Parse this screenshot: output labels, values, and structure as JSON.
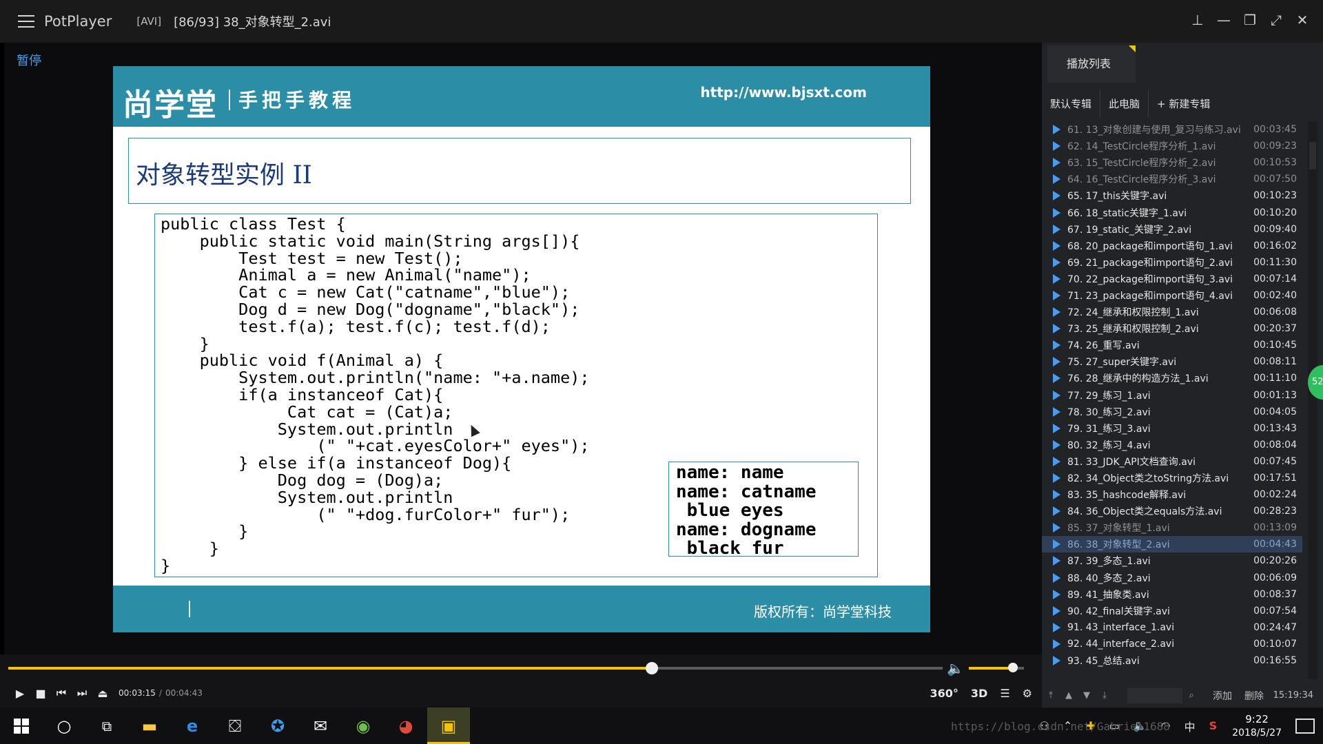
{
  "titlebar": {
    "app_name": "PotPlayer",
    "format": "[AVI]",
    "file_title": "[86/93] 38_对象转型_2.avi"
  },
  "video": {
    "pause_label": "暂停",
    "slide": {
      "logo": "尚学堂",
      "tagline": "手把手教程",
      "url": "http://www.bjsxt.com",
      "title": "对象转型实例 II",
      "code": "public class Test {\n    public static void main(String args[]){\n        Test test = new Test();\n        Animal a = new Animal(\"name\");\n        Cat c = new Cat(\"catname\",\"blue\");\n        Dog d = new Dog(\"dogname\",\"black\");\n        test.f(a); test.f(c); test.f(d);\n    }\n    public void f(Animal a) {\n        System.out.println(\"name: \"+a.name);\n        if(a instanceof Cat){\n             Cat cat = (Cat)a;\n            System.out.println\n                (\" \"+cat.eyesColor+\" eyes\");\n        } else if(a instanceof Dog){\n            Dog dog = (Dog)a;\n            System.out.println\n                (\" \"+dog.furColor+\" fur\");\n        }\n     }\n}",
      "output": "name: name\nname: catname\n blue eyes\nname: dogname\n black fur",
      "copyright": "版权所有：尚学堂科技"
    }
  },
  "playlist": {
    "tab_label": "播放列表",
    "sub_tabs": [
      "默认专辑",
      "此电脑",
      "+ 新建专辑"
    ],
    "items": [
      {
        "name": "61. 13_对象创建与使用_复习与练习.avi",
        "duration": "00:03:45",
        "state": "dim"
      },
      {
        "name": "62. 14_TestCircle程序分析_1.avi",
        "duration": "00:09:23",
        "state": "dim"
      },
      {
        "name": "63. 15_TestCircle程序分析_2.avi",
        "duration": "00:10:53",
        "state": "dim"
      },
      {
        "name": "64. 16_TestCircle程序分析_3.avi",
        "duration": "00:07:50",
        "state": "dim"
      },
      {
        "name": "65. 17_this关键字.avi",
        "duration": "00:10:23",
        "state": ""
      },
      {
        "name": "66. 18_static关键字_1.avi",
        "duration": "00:10:20",
        "state": ""
      },
      {
        "name": "67. 19_static_关键字_2.avi",
        "duration": "00:09:40",
        "state": ""
      },
      {
        "name": "68. 20_package和import语句_1.avi",
        "duration": "00:16:02",
        "state": ""
      },
      {
        "name": "69. 21_package和import语句_2.avi",
        "duration": "00:11:30",
        "state": ""
      },
      {
        "name": "70. 22_package和import语句_3.avi",
        "duration": "00:07:14",
        "state": ""
      },
      {
        "name": "71. 23_package和import语句_4.avi",
        "duration": "00:02:40",
        "state": ""
      },
      {
        "name": "72. 24_继承和权限控制_1.avi",
        "duration": "00:06:08",
        "state": ""
      },
      {
        "name": "73. 25_继承和权限控制_2.avi",
        "duration": "00:20:37",
        "state": ""
      },
      {
        "name": "74. 26_重写.avi",
        "duration": "00:10:45",
        "state": ""
      },
      {
        "name": "75. 27_super关键字.avi",
        "duration": "00:08:11",
        "state": ""
      },
      {
        "name": "76. 28_继承中的构造方法_1.avi",
        "duration": "00:11:10",
        "state": ""
      },
      {
        "name": "77. 29_练习_1.avi",
        "duration": "00:01:13",
        "state": ""
      },
      {
        "name": "78. 30_练习_2.avi",
        "duration": "00:04:05",
        "state": ""
      },
      {
        "name": "79. 31_练习_3.avi",
        "duration": "00:13:43",
        "state": ""
      },
      {
        "name": "80. 32_练习_4.avi",
        "duration": "00:08:04",
        "state": ""
      },
      {
        "name": "81. 33_JDK_API文档查询.avi",
        "duration": "00:07:45",
        "state": ""
      },
      {
        "name": "82. 34_Object类之toString方法.avi",
        "duration": "00:17:51",
        "state": ""
      },
      {
        "name": "83. 35_hashcode解释.avi",
        "duration": "00:02:24",
        "state": ""
      },
      {
        "name": "84. 36_Object类之equals方法.avi",
        "duration": "00:28:23",
        "state": ""
      },
      {
        "name": "85. 37_对象转型_1.avi",
        "duration": "00:13:09",
        "state": "dim"
      },
      {
        "name": "86. 38_对象转型_2.avi",
        "duration": "00:04:43",
        "state": "active"
      },
      {
        "name": "87. 39_多态_1.avi",
        "duration": "00:20:26",
        "state": ""
      },
      {
        "name": "88. 40_多态_2.avi",
        "duration": "00:06:09",
        "state": ""
      },
      {
        "name": "89. 41_抽象类.avi",
        "duration": "00:08:37",
        "state": ""
      },
      {
        "name": "90. 42_final关键字.avi",
        "duration": "00:07:54",
        "state": ""
      },
      {
        "name": "91. 43_interface_1.avi",
        "duration": "00:24:47",
        "state": ""
      },
      {
        "name": "92. 44_interface_2.avi",
        "duration": "00:10:07",
        "state": ""
      },
      {
        "name": "93. 45_总结.avi",
        "duration": "00:16:55",
        "state": ""
      }
    ],
    "add_label": "添加",
    "delete_label": "删除",
    "clock": "15:19:34",
    "badge": "52"
  },
  "controls": {
    "current_time": "00:03:15",
    "total_time": "00:04:43",
    "progress_fraction": 0.689,
    "volume_fraction": 0.8,
    "btn_360": "360°",
    "btn_3d": "3D"
  },
  "taskbar": {
    "time": "9:22",
    "date": "2018/5/27",
    "ime": "中",
    "watermark": "https://blog.csdn.net/Gabriel1688"
  },
  "colors": {
    "accent": "#f5c400",
    "slide_teal": "#2b8ea6",
    "pause_blue": "#3ea1f2",
    "active_row": "#2e3f57"
  }
}
